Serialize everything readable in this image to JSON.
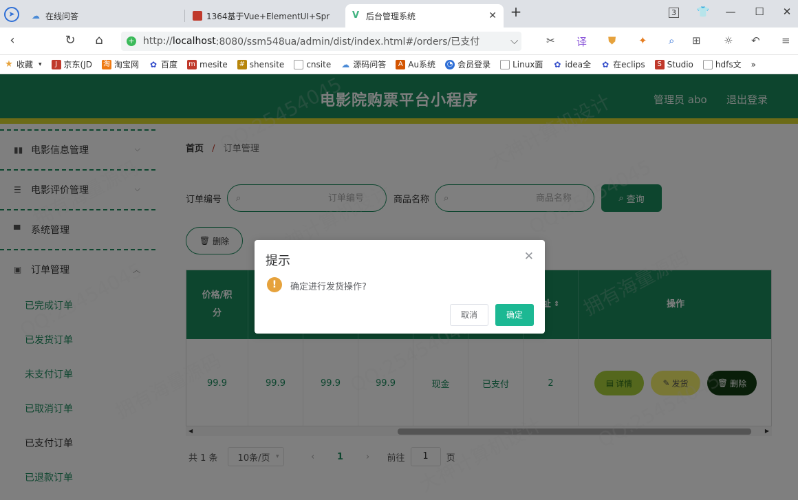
{
  "browser": {
    "tabs": [
      {
        "title": "在线问答"
      },
      {
        "title": "1364基于Vue+ElementUI+Spr"
      },
      {
        "title": "后台管理系统"
      }
    ],
    "tab_count_badge": "3",
    "url": {
      "prefix": "http://",
      "host": "localhost",
      "rest": ":8080/ssm548ua/admin/dist/index.html#/orders/已支付"
    },
    "bookmarks": [
      "收藏",
      "京东(JD",
      "淘宝网",
      "百度",
      "mesite",
      "shensite",
      "cnsite",
      "源码问答",
      "Au系统",
      "会员登录",
      "Linux面",
      "idea全",
      "在eclips",
      "Studio",
      "hdfs文",
      "»"
    ]
  },
  "header": {
    "title": "电影院购票平台小程序",
    "admin": "管理员 abo",
    "logout": "退出登录"
  },
  "sidebar": {
    "menus": [
      {
        "label": "电影信息管理",
        "icon": "bar-chart-icon"
      },
      {
        "label": "电影评价管理",
        "icon": "sliders-icon"
      },
      {
        "label": "系统管理",
        "icon": "cog-icon"
      },
      {
        "label": "订单管理",
        "icon": "clipboard-icon"
      }
    ],
    "submenu": [
      "已完成订单",
      "已发货订单",
      "未支付订单",
      "已取消订单",
      "已支付订单",
      "已退款订单"
    ]
  },
  "breadcrumb": {
    "home": "首页",
    "separator": "/",
    "current": "订单管理"
  },
  "search": {
    "order_no_label": "订单编号",
    "order_no_placeholder": "订单编号",
    "goods_label": "商品名称",
    "goods_placeholder": "商品名称",
    "query": "查询"
  },
  "toolbar": {
    "delete": "删除"
  },
  "table": {
    "columns": [
      "价格/积分",
      "",
      "",
      "",
      "",
      "",
      "址",
      "操作"
    ],
    "row": {
      "cells": [
        "99.9",
        "99.9",
        "99.9",
        "99.9",
        "现金",
        "已支付",
        "2"
      ],
      "actions": {
        "detail": "详情",
        "ship": "发货",
        "delete": "删除"
      }
    }
  },
  "pager": {
    "total": "共 1 条",
    "page_size": "10条/页",
    "prev": "‹",
    "current": "1",
    "next": "›",
    "goto": "前往",
    "goto_value": "1",
    "page_unit": "页"
  },
  "dialog": {
    "title": "提示",
    "message": "确定进行发货操作?",
    "cancel": "取消",
    "confirm": "确定"
  },
  "watermark": [
    "QQ:25454045",
    "拥有海量源码",
    "大神计算机设计"
  ],
  "colors": {
    "primary": "#1a8a5d",
    "accent_yellow": "#d9d62e",
    "confirm": "#1cb893"
  }
}
